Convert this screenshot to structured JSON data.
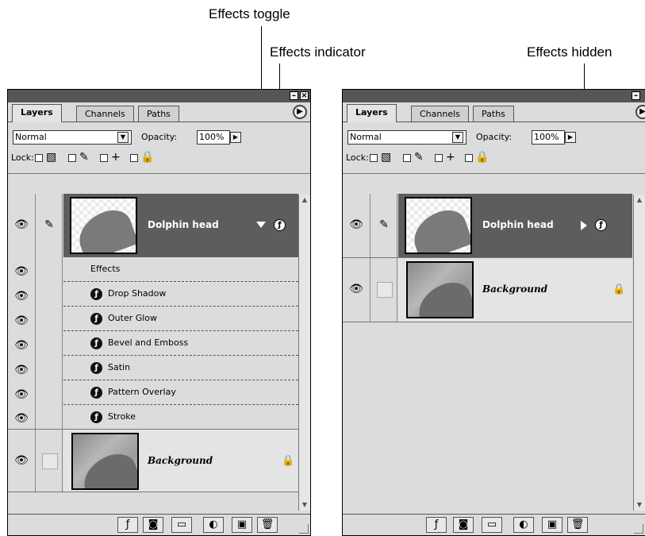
{
  "callouts": {
    "effects_toggle": "Effects toggle",
    "effects_indicator": "Effects indicator",
    "effects_hidden": "Effects hidden"
  },
  "panel": {
    "tabs": [
      "Layers",
      "Channels",
      "Paths"
    ],
    "blend_mode": "Normal",
    "opacity_label": "Opacity:",
    "opacity_value": "100%",
    "lock_label": "Lock:"
  },
  "left_panel": {
    "layer_name": "Dolphin head",
    "effects_header": "Effects",
    "effects": [
      "Drop Shadow",
      "Outer Glow",
      "Bevel and Emboss",
      "Satin",
      "Pattern Overlay",
      "Stroke"
    ],
    "background_name": "Background"
  },
  "right_panel": {
    "layer_name": "Dolphin head",
    "background_name": "Background"
  },
  "icons": {
    "visibility": "eye-icon",
    "link": "brush-link-icon",
    "effects": "fx-icon",
    "lock": "lock-icon",
    "panel_menu": "panel-menu-arrow-icon",
    "bottom": [
      "layer-style-icon",
      "mask-icon",
      "new-set-icon",
      "adjustment-layer-icon",
      "new-layer-icon",
      "trash-icon"
    ]
  },
  "colors": {
    "selected_row": "#5d5d5d",
    "panel_bg": "#dcdcdc",
    "titlebar": "#565656"
  }
}
